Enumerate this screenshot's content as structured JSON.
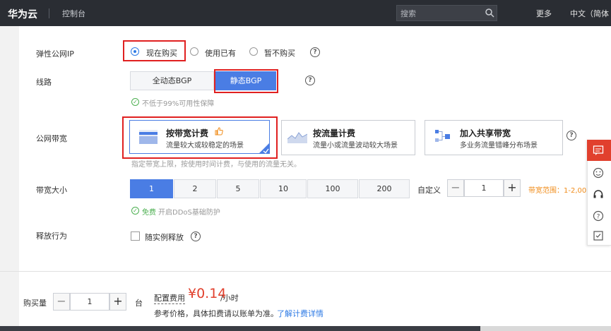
{
  "topbar": {
    "logo": "华为云",
    "console": "控制台",
    "search_placeholder": "搜索",
    "more": "更多",
    "lang": "中文（简体"
  },
  "eip": {
    "label": "弹性公网IP",
    "options": [
      "现在购买",
      "使用已有",
      "暂不购买"
    ],
    "selected": "现在购买"
  },
  "line": {
    "label": "线路",
    "options": [
      "全动态BGP",
      "静态BGP"
    ],
    "selected": "静态BGP",
    "note": "不低于99%可用性保障"
  },
  "billing": {
    "label": "公网带宽",
    "cards": [
      {
        "title": "按带宽计费",
        "subtitle": "流量较大或较稳定的场景",
        "selected": true
      },
      {
        "title": "按流量计费",
        "subtitle": "流量小或流量波动较大场景",
        "selected": false
      },
      {
        "title": "加入共享带宽",
        "subtitle": "多业务流量错峰分布场景",
        "selected": false
      }
    ],
    "note": "指定带宽上限，按使用时间计费，与使用的流量无关。"
  },
  "bandwidth": {
    "label": "带宽大小",
    "options": [
      "1",
      "2",
      "5",
      "10",
      "100",
      "200"
    ],
    "selected": "1",
    "custom_label": "自定义",
    "custom_value": "1",
    "range": "带宽范围：1-2,00",
    "ddos_free": "免费",
    "ddos_text": "开启DDoS基础防护"
  },
  "release": {
    "label": "释放行为",
    "checkbox_label": "随实例释放",
    "checked": false
  },
  "footer": {
    "qty_label": "购买量",
    "qty_value": "1",
    "unit": "台",
    "fee_label": "配置费用",
    "price": "¥0.14",
    "per": "/小时",
    "ref_text": "参考价格，具体扣费请以账单为准。",
    "link": "了解计费详情"
  },
  "colors": {
    "primary": "#4a7de4",
    "price": "#e1402d",
    "highlight": "#e02020",
    "range": "#f08c1a"
  }
}
